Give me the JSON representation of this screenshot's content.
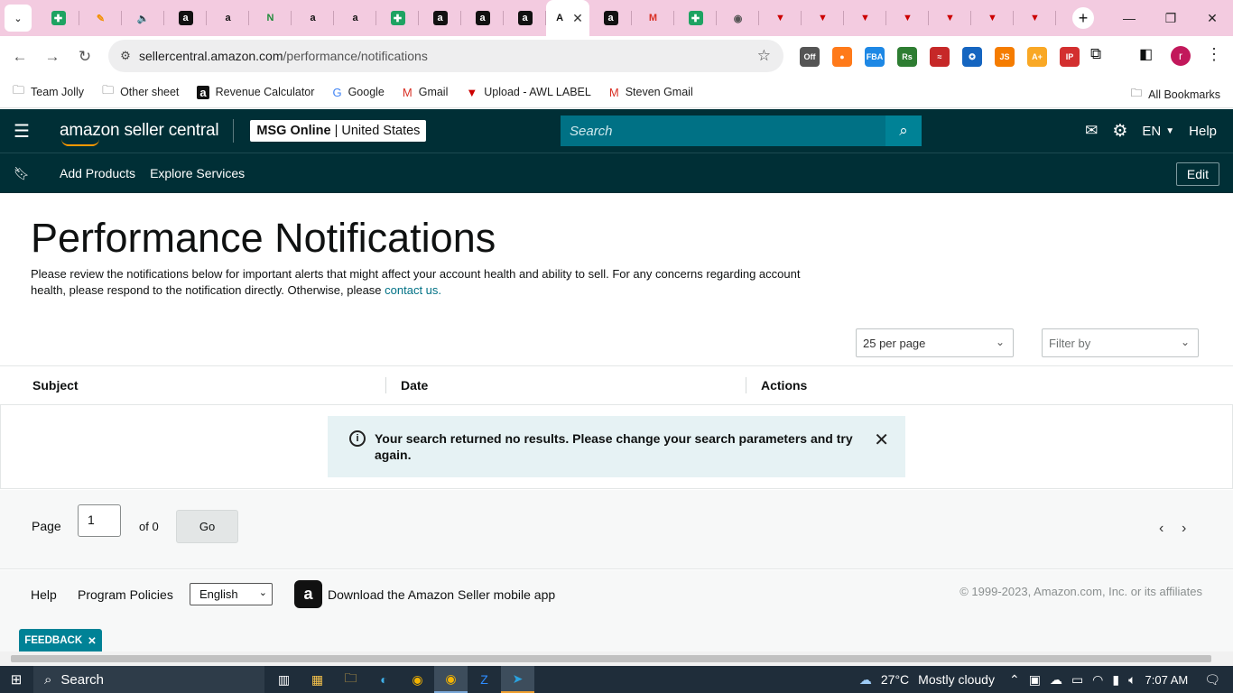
{
  "browser": {
    "tabs": [
      {
        "icon": "sheets-icon",
        "glyph": "✚",
        "style": "sheet"
      },
      {
        "icon": "pen-icon",
        "glyph": "✎",
        "style": "pen"
      },
      {
        "icon": "speaker-icon",
        "glyph": "🔈",
        "style": "speaker"
      },
      {
        "icon": "amazon-icon",
        "glyph": "a",
        "style": "amz"
      },
      {
        "icon": "amazon-smile-icon",
        "glyph": "a",
        "style": "amzw"
      },
      {
        "icon": "n-icon",
        "glyph": "N",
        "style": "green"
      },
      {
        "icon": "amazon-smile-icon",
        "glyph": "a",
        "style": "amzw"
      },
      {
        "icon": "amazon-smile-icon",
        "glyph": "a",
        "style": "amzw"
      },
      {
        "icon": "sheets-icon",
        "glyph": "✚",
        "style": "sheet"
      },
      {
        "icon": "amazon-icon",
        "glyph": "a",
        "style": "amz"
      },
      {
        "icon": "amazon-icon",
        "glyph": "a",
        "style": "amz"
      },
      {
        "icon": "amazon-icon",
        "glyph": "a",
        "style": "amz"
      },
      {
        "icon": "active-tab-icon",
        "glyph": "A",
        "style": "amzw",
        "active": true
      },
      {
        "icon": "amazon-icon",
        "glyph": "a",
        "style": "amz"
      },
      {
        "icon": "gmail-icon",
        "glyph": "M",
        "style": "gmail"
      },
      {
        "icon": "sheets-icon",
        "glyph": "✚",
        "style": "sheet"
      },
      {
        "icon": "chrome-icon",
        "glyph": "◉",
        "style": "chrome"
      },
      {
        "icon": "red-v-icon",
        "glyph": "▼",
        "style": "red"
      },
      {
        "icon": "red-v-icon",
        "glyph": "▼",
        "style": "red"
      },
      {
        "icon": "red-v-icon",
        "glyph": "▼",
        "style": "red"
      },
      {
        "icon": "red-v-icon",
        "glyph": "▼",
        "style": "red"
      },
      {
        "icon": "red-v-icon",
        "glyph": "▼",
        "style": "red"
      },
      {
        "icon": "red-v-icon",
        "glyph": "▼",
        "style": "red"
      },
      {
        "icon": "red-v-icon",
        "glyph": "▼",
        "style": "red"
      }
    ],
    "url_host": "sellercentral.amazon.com",
    "url_path": "/performance/notifications",
    "profile_initial": "r",
    "bookmarks": [
      {
        "label": "Team Jolly",
        "icon": "folder-icon"
      },
      {
        "label": "Other sheet",
        "icon": "folder-icon"
      },
      {
        "label": "Revenue Calculator",
        "icon": "amazon-icon"
      },
      {
        "label": "Google",
        "icon": "google-icon"
      },
      {
        "label": "Gmail",
        "icon": "gmail-icon"
      },
      {
        "label": "Upload - AWL LABEL",
        "icon": "red-v-icon"
      },
      {
        "label": "Steven Gmail",
        "icon": "gmail-icon"
      }
    ],
    "all_bookmarks": "All Bookmarks",
    "extensions": [
      {
        "name": "off-extension",
        "label": "Off",
        "color": "#555"
      },
      {
        "name": "orange-extension",
        "label": "●",
        "color": "#ff7a1a"
      },
      {
        "name": "fba-extension",
        "label": "FBA",
        "color": "#1e88e5"
      },
      {
        "name": "rs-extension",
        "label": "Rs",
        "color": "#2e7d32"
      },
      {
        "name": "sas-extension",
        "label": "≈",
        "color": "#c62828"
      },
      {
        "name": "keepa-extension",
        "label": "✪",
        "color": "#1565c0"
      },
      {
        "name": "js-extension",
        "label": "JS",
        "color": "#f57c00"
      },
      {
        "name": "scout-extension",
        "label": "A+",
        "color": "#f9a825"
      },
      {
        "name": "ip-alert-extension",
        "label": "IP",
        "color": "#d32f2f"
      }
    ]
  },
  "header": {
    "logo_text": "amazon seller central",
    "store_name": "MSG Online",
    "store_region": "| United States",
    "search_placeholder": "Search",
    "language": "EN",
    "help": "Help"
  },
  "subnav": {
    "links": [
      "Add Products",
      "Explore Services"
    ],
    "edit_label": "Edit"
  },
  "page": {
    "title": "Performance Notifications",
    "intro": "Please review the notifications below for important alerts that might affect your account health and ability to sell. For any concerns regarding account health, please respond to the notification directly. Otherwise, please ",
    "contact_link": "contact us.",
    "per_page": "25 per page",
    "filter_by": "Filter by"
  },
  "table": {
    "columns": [
      "Subject",
      "Date",
      "Actions"
    ],
    "empty_message": "Your search returned no results. Please change your search parameters and try again."
  },
  "pager": {
    "label": "Page",
    "value": "1",
    "of": "of 0",
    "go": "Go"
  },
  "footer": {
    "help": "Help",
    "program_policies": "Program Policies",
    "language": "English",
    "app_link": "Download the Amazon Seller mobile app",
    "copyright": "© 1999-2023, Amazon.com, Inc. or its affiliates"
  },
  "feedback": "FEEDBACK",
  "taskbar": {
    "search": "Search",
    "temperature": "27°C",
    "weather": "Mostly cloudy",
    "time": "7:07 AM"
  }
}
